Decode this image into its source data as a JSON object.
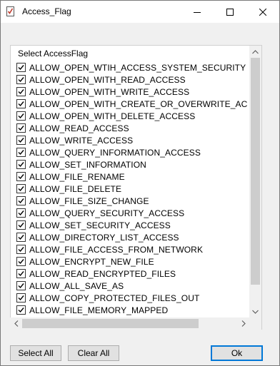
{
  "window": {
    "title": "Access_Flag",
    "icon": "document-check-icon",
    "controls": [
      "minimize-icon",
      "maximize-icon",
      "close-icon"
    ]
  },
  "group": {
    "label": "Select AccessFlag"
  },
  "flags": [
    {
      "label": "ALLOW_OPEN_WTIH_ACCESS_SYSTEM_SECURITY",
      "checked": true
    },
    {
      "label": "ALLOW_OPEN_WITH_READ_ACCESS",
      "checked": true
    },
    {
      "label": "ALLOW_OPEN_WITH_WRITE_ACCESS",
      "checked": true
    },
    {
      "label": "ALLOW_OPEN_WITH_CREATE_OR_OVERWRITE_ACCESS",
      "checked": true
    },
    {
      "label": "ALLOW_OPEN_WITH_DELETE_ACCESS",
      "checked": true
    },
    {
      "label": "ALLOW_READ_ACCESS",
      "checked": true
    },
    {
      "label": "ALLOW_WRITE_ACCESS",
      "checked": true
    },
    {
      "label": "ALLOW_QUERY_INFORMATION_ACCESS",
      "checked": true
    },
    {
      "label": "ALLOW_SET_INFORMATION",
      "checked": true
    },
    {
      "label": "ALLOW_FILE_RENAME",
      "checked": true
    },
    {
      "label": "ALLOW_FILE_DELETE",
      "checked": true
    },
    {
      "label": "ALLOW_FILE_SIZE_CHANGE",
      "checked": true
    },
    {
      "label": "ALLOW_QUERY_SECURITY_ACCESS",
      "checked": true
    },
    {
      "label": "ALLOW_SET_SECURITY_ACCESS",
      "checked": true
    },
    {
      "label": "ALLOW_DIRECTORY_LIST_ACCESS",
      "checked": true
    },
    {
      "label": "ALLOW_FILE_ACCESS_FROM_NETWORK",
      "checked": true
    },
    {
      "label": "ALLOW_ENCRYPT_NEW_FILE",
      "checked": true
    },
    {
      "label": "ALLOW_READ_ENCRYPTED_FILES",
      "checked": true
    },
    {
      "label": "ALLOW_ALL_SAVE_AS",
      "checked": true
    },
    {
      "label": "ALLOW_COPY_PROTECTED_FILES_OUT",
      "checked": true
    },
    {
      "label": "ALLOW_FILE_MEMORY_MAPPED",
      "checked": true
    }
  ],
  "buttons": {
    "select_all": "Select All",
    "clear_all": "Clear All",
    "ok": "Ok"
  },
  "colors": {
    "title_bar": "#ffffff",
    "dialog_bg": "#f0f0f0",
    "list_bg": "#ffffff",
    "scroll_thumb": "#cdcdcd",
    "default_button_border": "#0078d7"
  }
}
